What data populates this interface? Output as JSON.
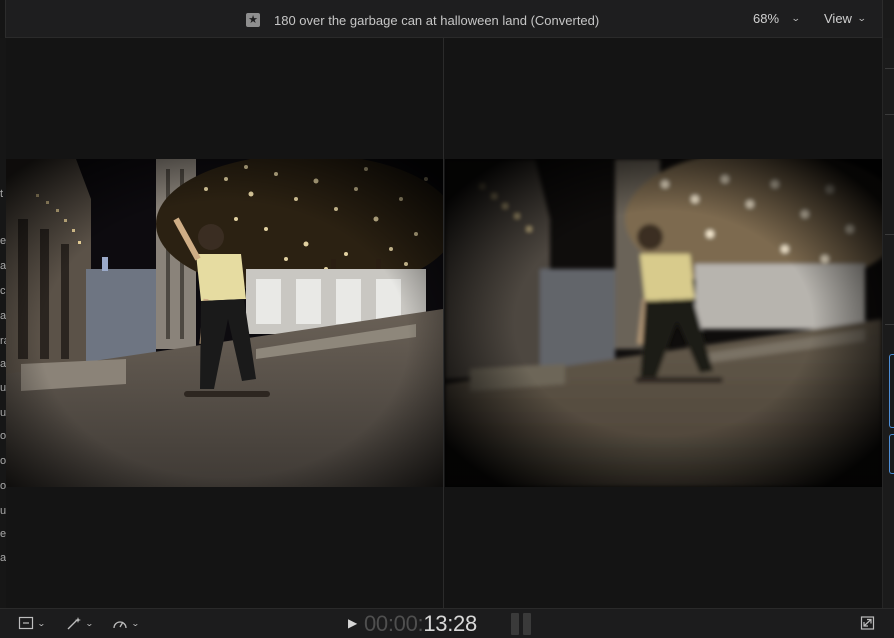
{
  "header": {
    "title": "180 over the garbage can at halloween land (Converted)",
    "zoom": "68%",
    "view_menu": "View"
  },
  "icons": {
    "title_icon": "favorite-star-icon",
    "zoom_menu": "chevron-down-icon",
    "view_menu": "chevron-down-icon"
  },
  "viewer": {
    "left_frame": "original skateboarding video frame",
    "right_frame": "converted skateboarding video frame"
  },
  "left_sidebar_letters": [
    "t",
    "el",
    "ar",
    "c",
    "a",
    "ra",
    "a",
    "ur",
    "ur",
    "o",
    "o",
    "o",
    "u",
    "e",
    "a"
  ],
  "footer": {
    "timecode_dim": "00:00:",
    "timecode_bright": "13:28"
  },
  "colors": {
    "background": "#141414",
    "toolbar": "#1e1e1f",
    "accent": "#4e8fd8"
  }
}
